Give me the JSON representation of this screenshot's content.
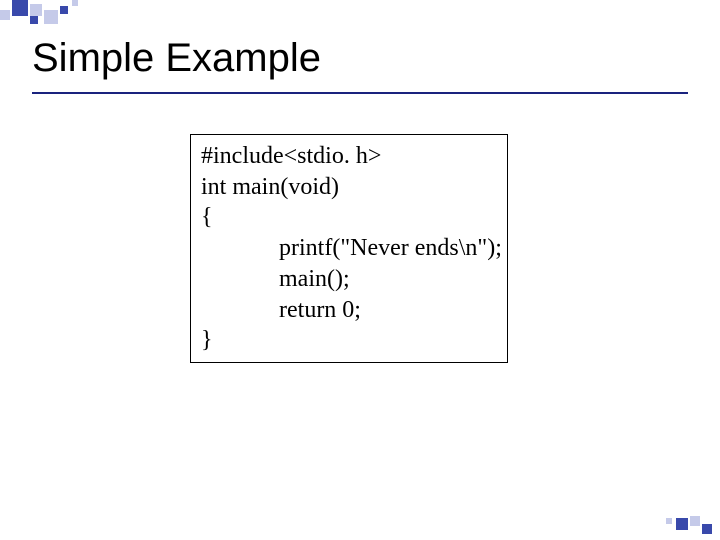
{
  "slide": {
    "title": "Simple Example"
  },
  "code": {
    "lines": [
      "#include<stdio. h>",
      "int main(void)",
      "{",
      "printf(\"Never ends\\n\");",
      "main();",
      "return 0;",
      "}"
    ]
  }
}
